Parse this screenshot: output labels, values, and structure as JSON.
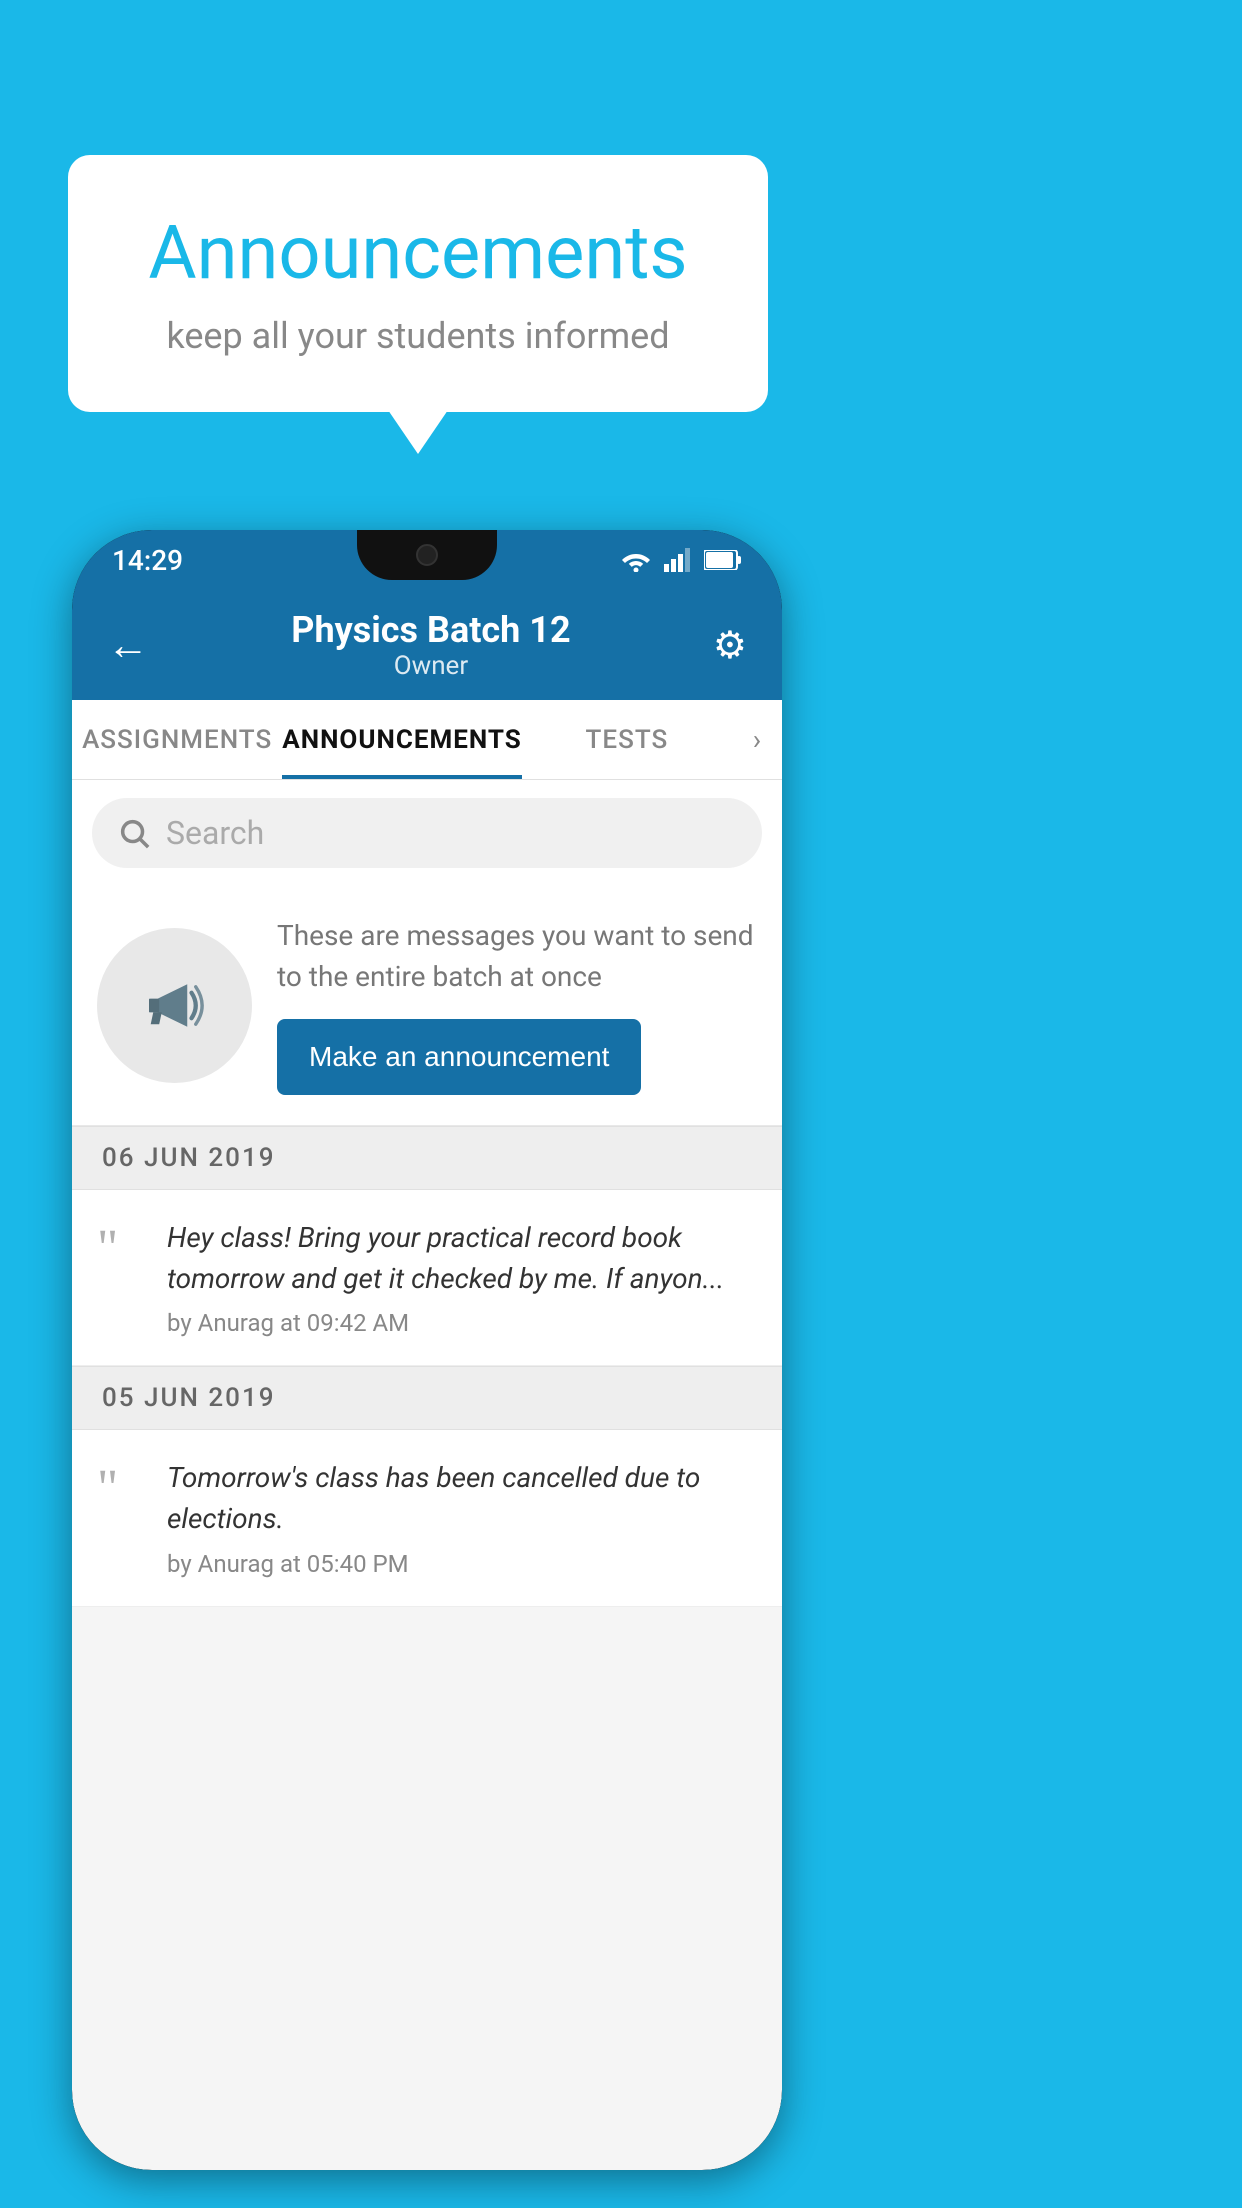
{
  "background": {
    "color": "#1ab8e8"
  },
  "speech_bubble": {
    "title": "Announcements",
    "subtitle": "keep all your students informed"
  },
  "phone": {
    "status_bar": {
      "time": "14:29"
    },
    "header": {
      "title": "Physics Batch 12",
      "subtitle": "Owner",
      "back_icon": "←",
      "settings_icon": "⚙"
    },
    "tabs": [
      {
        "label": "ASSIGNMENTS",
        "active": false
      },
      {
        "label": "ANNOUNCEMENTS",
        "active": true
      },
      {
        "label": "TESTS",
        "active": false
      }
    ],
    "search": {
      "placeholder": "Search"
    },
    "promo": {
      "description": "These are messages you want to send to the entire batch at once",
      "button_label": "Make an announcement"
    },
    "announcements": [
      {
        "date": "06  JUN  2019",
        "text": "Hey class! Bring your practical record book tomorrow and get it checked by me. If anyon...",
        "meta": "by Anurag at 09:42 AM"
      },
      {
        "date": "05  JUN  2019",
        "text": "Tomorrow's class has been cancelled due to elections.",
        "meta": "by Anurag at 05:40 PM"
      }
    ]
  }
}
